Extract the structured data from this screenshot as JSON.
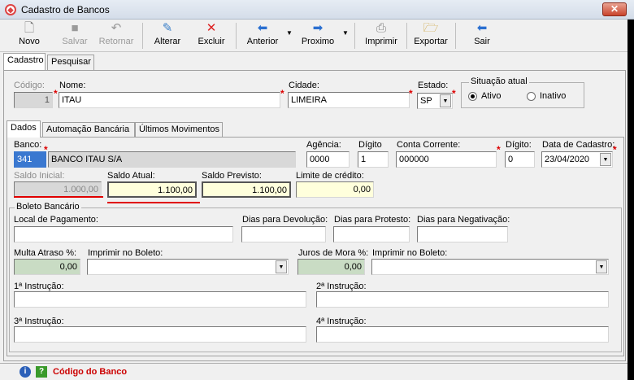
{
  "window": {
    "title": "Cadastro de Bancos",
    "close_label": "✕"
  },
  "toolbar": {
    "novo": "Novo",
    "salvar": "Salvar",
    "retornar": "Retornar",
    "alterar": "Alterar",
    "excluir": "Excluir",
    "anterior": "Anterior",
    "proximo": "Proximo",
    "imprimir": "Imprimir",
    "exportar": "Exportar",
    "sair": "Sair"
  },
  "main_tabs": [
    "Cadastro",
    "Pesquisar"
  ],
  "header": {
    "codigo_label": "Código:",
    "codigo_value": "1",
    "nome_label": "Nome:",
    "nome_value": "ITAU",
    "cidade_label": "Cidade:",
    "cidade_value": "LIMEIRA",
    "estado_label": "Estado:",
    "estado_value": "SP",
    "situacao_label": "Situação atual",
    "ativo_label": "Ativo",
    "inativo_label": "Inativo",
    "situacao_selected": "Ativo"
  },
  "sub_tabs": [
    "Dados",
    "Automação Bancária",
    "Últimos Movimentos"
  ],
  "dados": {
    "banco_label": "Banco:",
    "banco_code": "341",
    "banco_name": "BANCO ITAU S/A",
    "agencia_label": "Agência:",
    "agencia_value": "0000",
    "digito_label": "Dígito",
    "digito_value": "1",
    "conta_label": "Conta Corrente:",
    "conta_value": "000000",
    "digito2_label": "Dígito:",
    "digito2_value": "0",
    "data_label": "Data de Cadastro:",
    "data_value": "23/04/2020",
    "saldo_inicial_label": "Saldo Inicial:",
    "saldo_inicial_value": "1.000,00",
    "saldo_atual_label": "Saldo Atual:",
    "saldo_atual_value": "1.100,00",
    "saldo_previsto_label": "Saldo Previsto:",
    "saldo_previsto_value": "1.100,00",
    "limite_label": "Limite de crédito:",
    "limite_value": "0,00"
  },
  "boleto": {
    "group_label": "Boleto Bancário",
    "local_label": "Local de Pagamento:",
    "dias_devolucao_label": "Dias para Devolução:",
    "dias_protesto_label": "Dias para Protesto:",
    "dias_negativacao_label": "Dias para Negativação:",
    "multa_label": "Multa Atraso %:",
    "multa_value": "0,00",
    "imprimir1_label": "Imprimir no Boleto:",
    "juros_label": "Juros de Mora %:",
    "juros_value": "0,00",
    "imprimir2_label": "Imprimir no Boleto:",
    "instr1_label": "1ª Instrução:",
    "instr2_label": "2ª Instrução:",
    "instr3_label": "3ª Instrução:",
    "instr4_label": "4ª Instrução:"
  },
  "status": {
    "text": "Código do Banco",
    "info_icon": "i",
    "help_icon": "?"
  },
  "colors": {
    "required": "#dd0000",
    "status_text": "#cc0000",
    "highlight": "#e00000"
  }
}
